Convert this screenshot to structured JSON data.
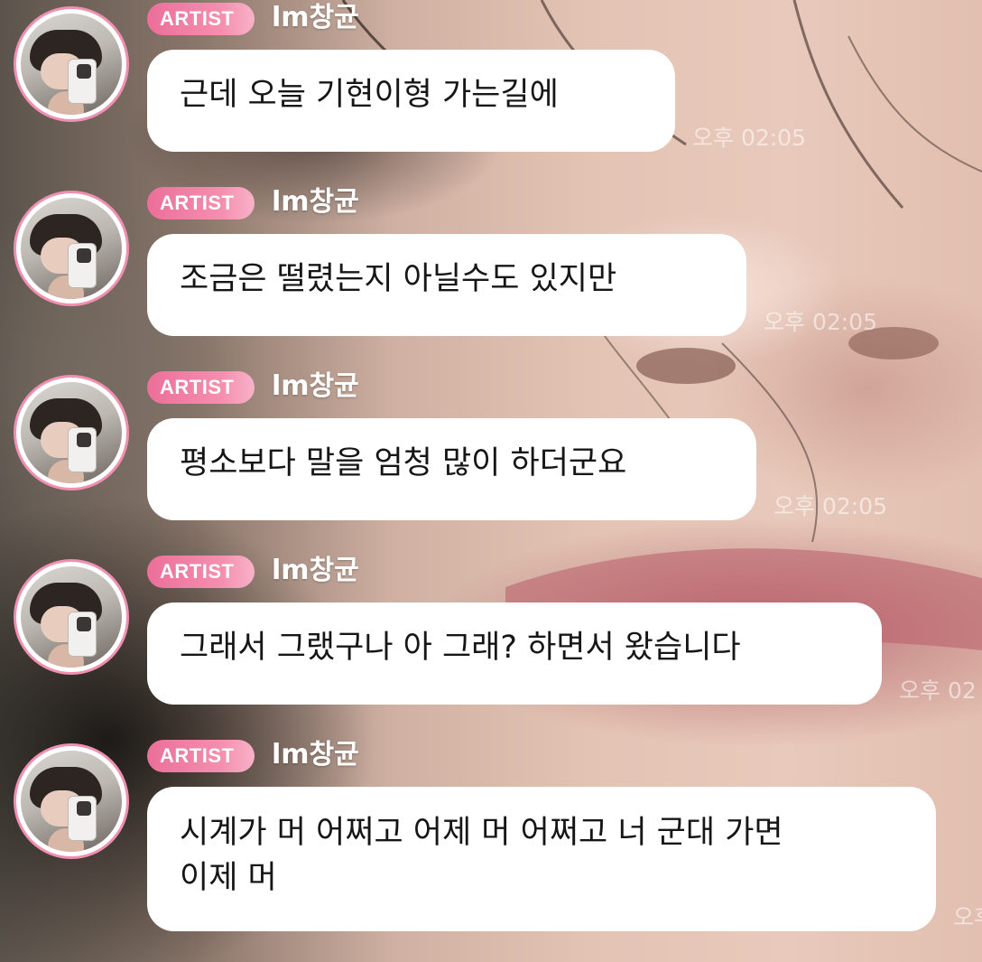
{
  "messages": [
    {
      "badge": "ARTIST",
      "sender": "lm창균",
      "text": "근데 오늘 기현이형 가는길에",
      "time": "오후 02:05"
    },
    {
      "badge": "ARTIST",
      "sender": "lm창균",
      "text": "조금은 떨렸는지 아닐수도 있지만",
      "time": "오후 02:05"
    },
    {
      "badge": "ARTIST",
      "sender": "lm창균",
      "text": "평소보다 말을 엄청 많이 하더군요",
      "time": "오후 02:05"
    },
    {
      "badge": "ARTIST",
      "sender": "lm창균",
      "text": "그래서 그랬구나 아 그래? 하면서 왔습니다",
      "time": "오후 02"
    },
    {
      "badge": "ARTIST",
      "sender": "lm창균",
      "text_line1": "시계가 머 어쩌고 어제 머 어쩌고 너 군대 가면",
      "text_line2": "이제 머",
      "time": "오후"
    }
  ],
  "colors": {
    "badge_pink": "#ec6f99",
    "avatar_ring": "#f08fb0",
    "bubble_bg": "#ffffff"
  }
}
